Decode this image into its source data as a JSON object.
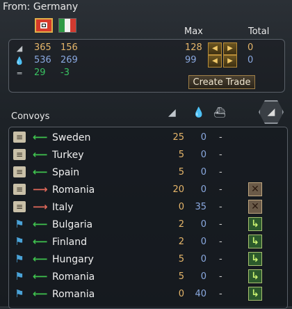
{
  "header": {
    "title": "From: Germany"
  },
  "columns": {
    "max": "Max",
    "total": "Total"
  },
  "resources": [
    {
      "icon": "steel-icon",
      "a": "365",
      "b": "156",
      "max": "128",
      "total": "0",
      "color": "gold"
    },
    {
      "icon": "oil-icon",
      "a": "536",
      "b": "269",
      "max": "99",
      "total": "0",
      "color": "blue"
    },
    {
      "icon": "convoy-icon",
      "a": "29",
      "b": "-3",
      "max": "",
      "total": "",
      "color": "green"
    }
  ],
  "create_trade": "Create Trade",
  "convoys": {
    "title": "Convoys",
    "rows": [
      {
        "kind": "trade",
        "dir": "in",
        "country": "Sweden",
        "steel": "25",
        "oil": "0",
        "conv": "-",
        "action": ""
      },
      {
        "kind": "trade",
        "dir": "in",
        "country": "Turkey",
        "steel": "5",
        "oil": "0",
        "conv": "-",
        "action": ""
      },
      {
        "kind": "trade",
        "dir": "in",
        "country": "Spain",
        "steel": "5",
        "oil": "0",
        "conv": "-",
        "action": ""
      },
      {
        "kind": "trade",
        "dir": "out",
        "country": "Romania",
        "steel": "20",
        "oil": "0",
        "conv": "-",
        "action": "cancel"
      },
      {
        "kind": "trade",
        "dir": "out",
        "country": "Italy",
        "steel": "0",
        "oil": "35",
        "conv": "-",
        "action": "cancel"
      },
      {
        "kind": "flag",
        "dir": "in",
        "country": "Bulgaria",
        "steel": "2",
        "oil": "0",
        "conv": "-",
        "action": "send"
      },
      {
        "kind": "flag",
        "dir": "in",
        "country": "Finland",
        "steel": "2",
        "oil": "0",
        "conv": "-",
        "action": "send"
      },
      {
        "kind": "flag",
        "dir": "in",
        "country": "Hungary",
        "steel": "5",
        "oil": "0",
        "conv": "-",
        "action": "send"
      },
      {
        "kind": "flag",
        "dir": "in",
        "country": "Romania",
        "steel": "5",
        "oil": "0",
        "conv": "-",
        "action": "send"
      },
      {
        "kind": "flag",
        "dir": "in",
        "country": "Romania",
        "steel": "0",
        "oil": "40",
        "conv": "-",
        "action": "send"
      }
    ]
  }
}
